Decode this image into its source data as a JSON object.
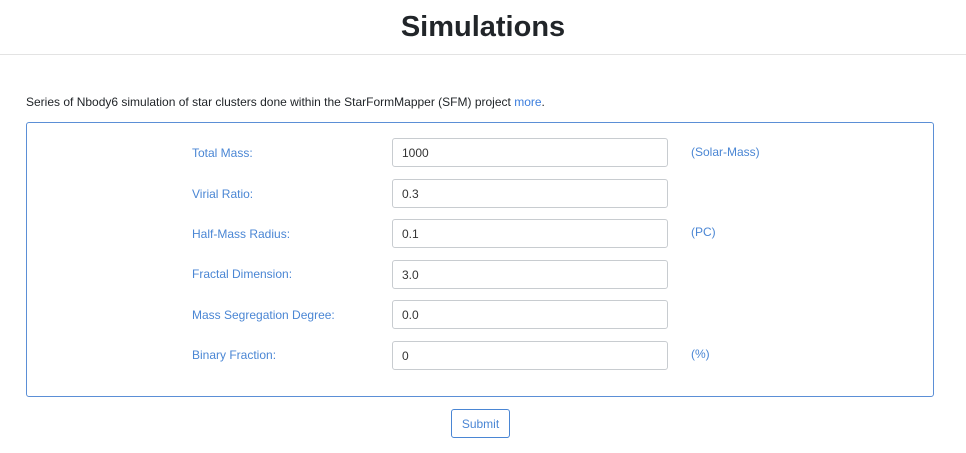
{
  "header": {
    "title": "Simulations"
  },
  "intro": {
    "text": "Series of Nbody6 simulation of star clusters done within the StarFormMapper (SFM) project ",
    "link_text": "more",
    "suffix": "."
  },
  "form": {
    "fields": [
      {
        "label": "Total Mass:",
        "value": "1000",
        "unit": "(Solar-Mass)"
      },
      {
        "label": "Virial Ratio:",
        "value": "0.3",
        "unit": ""
      },
      {
        "label": "Half-Mass Radius:",
        "value": "0.1",
        "unit": "(PC)"
      },
      {
        "label": "Fractal Dimension:",
        "value": "3.0",
        "unit": ""
      },
      {
        "label": "Mass Segregation Degree:",
        "value": "0.0",
        "unit": ""
      },
      {
        "label": "Binary Fraction:",
        "value": "0",
        "unit": "(%)"
      }
    ],
    "submit_label": "Submit"
  },
  "colors": {
    "accent": "#4a86d4",
    "border": "#5b8fd6"
  }
}
